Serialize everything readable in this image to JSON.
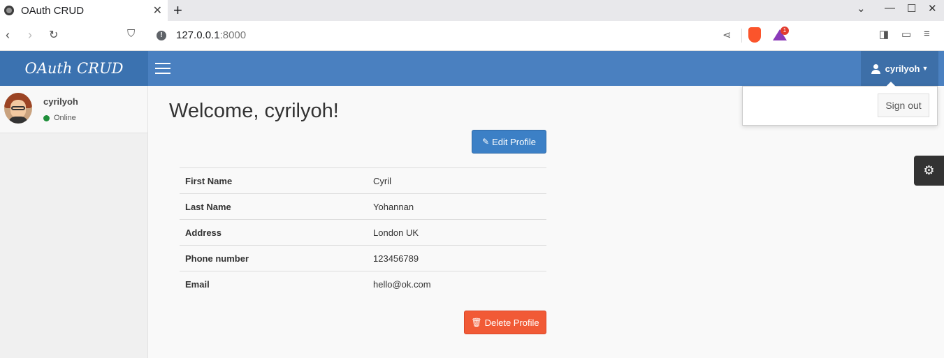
{
  "browser": {
    "tab_title": "OAuth CRUD",
    "tab_close": "✕",
    "new_tab": "+",
    "url_host": "127.0.0.1",
    "url_port": ":8000",
    "brave_badge": "1"
  },
  "header": {
    "logo": "OAuth CRUD",
    "user_menu_label": "cyrilyoh"
  },
  "dropdown": {
    "signout_label": "Sign out"
  },
  "sidebar": {
    "user_name": "cyrilyoh",
    "status": "Online"
  },
  "main": {
    "welcome": "Welcome, cyrilyoh!",
    "edit_button": "Edit Profile",
    "delete_button": "Delete Profile",
    "profile_rows": [
      {
        "label": "First Name",
        "value": "Cyril"
      },
      {
        "label": "Last Name",
        "value": "Yohannan"
      },
      {
        "label": "Address",
        "value": "London UK"
      },
      {
        "label": "Phone number",
        "value": "123456789"
      },
      {
        "label": "Email",
        "value": "hello@ok.com"
      }
    ]
  },
  "colors": {
    "header": "#4a80c0",
    "logo_bg": "#3b72b0",
    "edit_button": "#3c80c6",
    "delete_button": "#f15a36",
    "online": "#1f8f3a"
  }
}
